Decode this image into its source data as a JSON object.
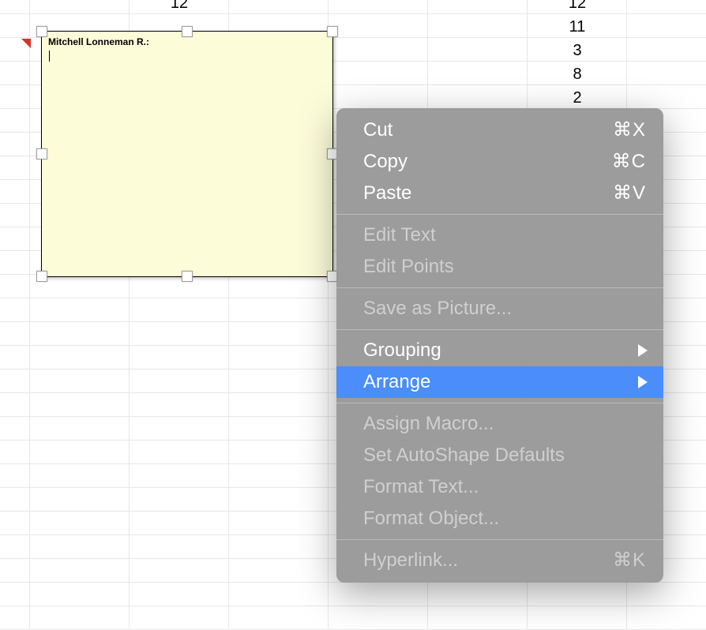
{
  "cells": {
    "col_b": [
      "12"
    ],
    "col_f": [
      "12",
      "11",
      "3",
      "8",
      "2"
    ]
  },
  "comment": {
    "author_label": "Mitchell Lonneman R.:"
  },
  "context_menu": {
    "cut": {
      "label": "Cut",
      "shortcut": "⌘X"
    },
    "copy": {
      "label": "Copy",
      "shortcut": "⌘C"
    },
    "paste": {
      "label": "Paste",
      "shortcut": "⌘V"
    },
    "edit_text": {
      "label": "Edit Text"
    },
    "edit_points": {
      "label": "Edit Points"
    },
    "save_picture": {
      "label": "Save as Picture..."
    },
    "grouping": {
      "label": "Grouping"
    },
    "arrange": {
      "label": "Arrange"
    },
    "assign_macro": {
      "label": "Assign Macro..."
    },
    "autoshape": {
      "label": "Set AutoShape Defaults"
    },
    "format_text": {
      "label": "Format Text..."
    },
    "format_obj": {
      "label": "Format Object..."
    },
    "hyperlink": {
      "label": "Hyperlink...",
      "shortcut": "⌘K"
    }
  }
}
